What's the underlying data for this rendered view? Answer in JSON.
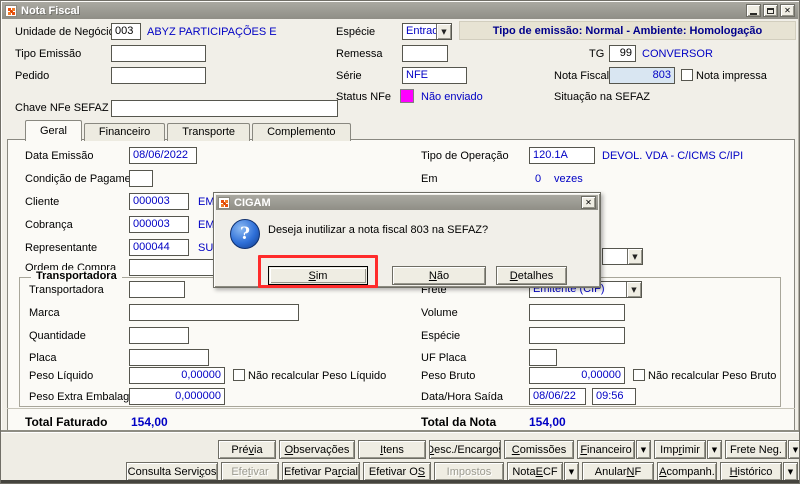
{
  "colors": {
    "accent_blue": "#0000C4",
    "navy_banner_text": "#00008B",
    "banner_bg": "#E7E3D3",
    "status_magenta": "#FF00FF",
    "nota_fiscal_field_bg": "#D9E6F2",
    "annotation_red": "#FF2B2B"
  },
  "window": {
    "title": "Nota Fiscal"
  },
  "header": {
    "unidade_label": "Unidade de Negócio",
    "unidade_code": "003",
    "unidade_name": "ABYZ PARTICIPAÇÕES E",
    "especie_label": "Espécie",
    "especie_value": "Entrada",
    "banner": "Tipo de emissão: Normal - Ambiente: Homologação",
    "tipo_emissao_label": "Tipo Emissão",
    "remessa_label": "Remessa",
    "tg_label": "TG",
    "tg_value": "99",
    "tg_name": "CONVERSOR",
    "pedido_label": "Pedido",
    "serie_label": "Série",
    "serie_value": "NFE",
    "nota_fiscal_label": "Nota Fiscal",
    "nota_fiscal_value": "803",
    "nota_impressa_label": "Nota impressa",
    "status_nfe_label": "Status NFe",
    "status_nfe_value": "Não enviado",
    "situacao_label": "Situação na SEFAZ",
    "chave_label": "Chave NFe SEFAZ"
  },
  "tabs": [
    {
      "id": "geral",
      "label": "Geral",
      "active": true
    },
    {
      "id": "financeiro",
      "label": "Financeiro"
    },
    {
      "id": "transporte",
      "label": "Transporte"
    },
    {
      "id": "complemento",
      "label": "Complemento"
    }
  ],
  "geral": {
    "data_emissao_label": "Data Emissão",
    "data_emissao": "08/06/2022",
    "tipo_operacao_label": "Tipo de Operação",
    "tipo_operacao_code": "120.1A",
    "tipo_operacao_desc": "DEVOL. VDA - C/ICMS C/IPI",
    "condicao_label": "Condição de Pagamento",
    "em_label": "Em",
    "em_value": "0",
    "em_suffix": "vezes",
    "cliente_label": "Cliente",
    "cliente_code": "000003",
    "cliente_name_partial": "EM",
    "cobranca_label": "Cobrança",
    "cobranca_code": "000003",
    "cobranca_name_partial": "EM",
    "representante_label": "Representante",
    "representante_code": "000044",
    "representante_name_partial": "SU",
    "ordem_compra_label": "Ordem de Compra",
    "group_title": "Transportadora",
    "transportadora_label": "Transportadora",
    "frete_label": "Frete",
    "frete_value": "Emitente (CIF)",
    "marca_label": "Marca",
    "volume_label": "Volume",
    "quantidade_label": "Quantidade",
    "especie_label": "Espécie",
    "placa_label": "Placa",
    "uf_placa_label": "UF Placa",
    "peso_liquido_label": "Peso Líquido",
    "peso_liquido_value": "0,00000",
    "nao_recalc_liquido_label": "Não recalcular Peso Líquido",
    "peso_bruto_label": "Peso Bruto",
    "peso_bruto_value": "0,00000",
    "nao_recalc_bruto_label": "Não recalcular Peso Bruto",
    "peso_extra_label": "Peso Extra Embalagem",
    "peso_extra_value": "0,000000",
    "data_hora_label": "Data/Hora Saída",
    "data_saida_value": "08/06/22",
    "hora_saida_value": "09:56",
    "total_faturado_label": "Total Faturado",
    "total_faturado_value": "154,00",
    "total_nota_label": "Total da Nota",
    "total_nota_value": "154,00"
  },
  "dialog": {
    "title": "CIGAM",
    "message": "Deseja inutilizar a nota fiscal 803 na SEFAZ?",
    "buttons": [
      {
        "id": "sim",
        "label": "&Sim"
      },
      {
        "id": "nao",
        "label": "&Não"
      },
      {
        "id": "detalhes",
        "label": "&Detalhes"
      }
    ]
  },
  "footer": {
    "row1": [
      {
        "id": "previa",
        "label": "Pré&via"
      },
      {
        "id": "observacoes",
        "label": "&Observações"
      },
      {
        "id": "itens",
        "label": "&Itens"
      },
      {
        "id": "desc-encargos",
        "label": "&Desc./Encargos"
      },
      {
        "id": "comissoes",
        "label": "&Comissões"
      },
      {
        "id": "financeiro",
        "label": "&Financeiro",
        "arrow": true
      },
      {
        "id": "imprimir",
        "label": "Imp&rimir",
        "arrow": true
      },
      {
        "id": "frete-neg",
        "label": "Frete Neg.",
        "arrow": true
      }
    ],
    "row2": [
      {
        "id": "consulta-servicos",
        "label": "Consulta Servi&ços"
      },
      {
        "id": "efetivar",
        "label": "Efe&tivar",
        "disabled": true
      },
      {
        "id": "efetivar-parcial",
        "label": "Efetivar Pa&rcial"
      },
      {
        "id": "efetivar-os",
        "label": "Efetivar O&S"
      },
      {
        "id": "impostos",
        "label": "Impostos",
        "disabled": true
      },
      {
        "id": "nota-ecf",
        "label": "Nota &ECF",
        "arrow": true
      },
      {
        "id": "anular-nf",
        "label": "Anular &NF"
      },
      {
        "id": "acompanh",
        "label": "&Acompanh."
      },
      {
        "id": "historico",
        "label": "&Histórico",
        "arrow": true
      }
    ]
  }
}
